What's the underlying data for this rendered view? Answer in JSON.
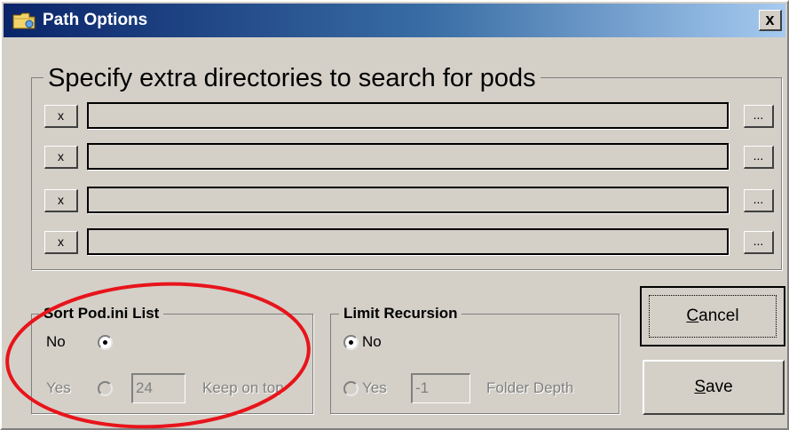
{
  "window": {
    "title": "Path Options",
    "close_label": "x"
  },
  "directories": {
    "heading": "Specify extra directories to search for pods",
    "rows": [
      {
        "remove_label": "x",
        "path": "",
        "browse_label": "..."
      },
      {
        "remove_label": "x",
        "path": "",
        "browse_label": "..."
      },
      {
        "remove_label": "x",
        "path": "",
        "browse_label": "..."
      },
      {
        "remove_label": "x",
        "path": "",
        "browse_label": "..."
      }
    ]
  },
  "sort": {
    "heading": "Sort Pod.ini List",
    "no_label": "No",
    "yes_label": "Yes",
    "selected": "No",
    "count_value": "24",
    "keep_label": "Keep on top"
  },
  "recursion": {
    "heading": "Limit Recursion",
    "no_label": "No",
    "yes_label": "Yes",
    "selected": "No",
    "depth_value": "-1",
    "depth_label": "Folder Depth"
  },
  "buttons": {
    "cancel_key": "C",
    "cancel_rest": "ancel",
    "save_key": "S",
    "save_rest": "ave"
  },
  "annotation": {
    "color": "#e8141b",
    "shape": "ellipse"
  },
  "colors": {
    "face": "#d4d0c8",
    "title_start": "#0a246a",
    "title_end": "#a6caf0"
  }
}
